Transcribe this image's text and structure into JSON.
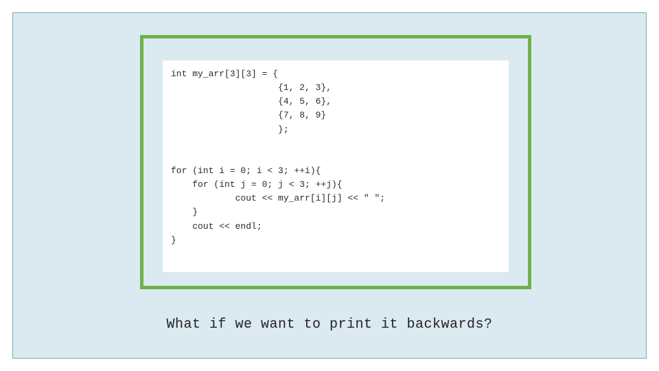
{
  "slide": {
    "code_lines": [
      "int my_arr[3][3] = {",
      "                    {1, 2, 3},",
      "                    {4, 5, 6},",
      "                    {7, 8, 9}",
      "                    };",
      "",
      "",
      "for (int i = 0; i < 3; ++i){",
      "    for (int j = 0; j < 3; ++j){",
      "            cout << my_arr[i][j] << \" \";",
      "    }",
      "    cout << endl;",
      "}"
    ],
    "caption": "What if we want to print it backwards?"
  },
  "colors": {
    "panel_bg": "#dbeaf0",
    "panel_border": "#7aa7b3",
    "frame_border": "#6fb24a",
    "code_bg": "#ffffff",
    "text": "#2b2b2b"
  }
}
